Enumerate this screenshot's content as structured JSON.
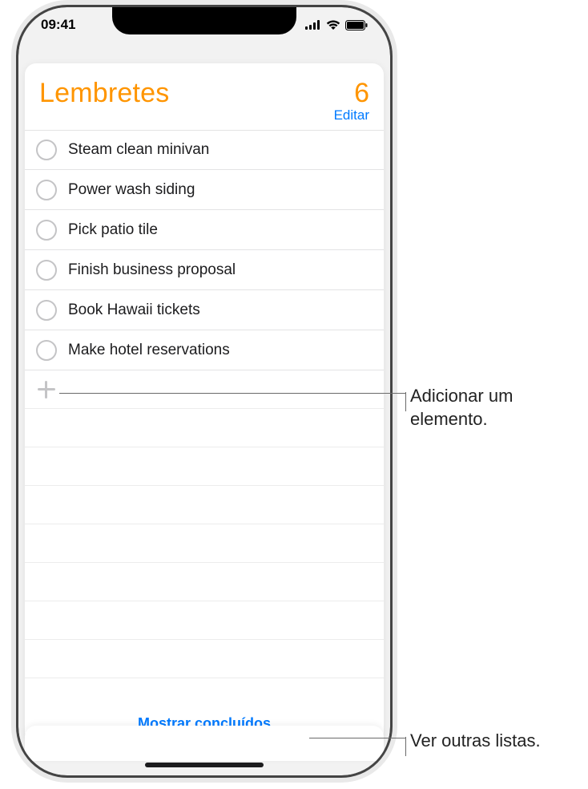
{
  "status": {
    "time": "09:41"
  },
  "header": {
    "title": "Lembretes",
    "count": "6",
    "edit": "Editar"
  },
  "reminders": [
    {
      "text": "Steam clean minivan"
    },
    {
      "text": "Power wash siding"
    },
    {
      "text": "Pick patio tile"
    },
    {
      "text": "Finish business proposal"
    },
    {
      "text": "Book Hawaii tickets"
    },
    {
      "text": "Make hotel reservations"
    }
  ],
  "footer": {
    "show_completed": "Mostrar concluídos"
  },
  "callouts": {
    "add_item": "Adicionar um elemento.",
    "other_lists": "Ver outras listas."
  }
}
